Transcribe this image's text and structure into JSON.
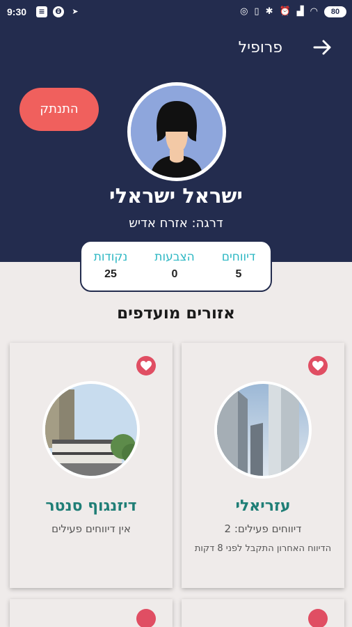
{
  "status_bar": {
    "time": "9:30",
    "battery": "80"
  },
  "header": {
    "title": "פרופיל",
    "back_icon": "arrow-right-icon",
    "logout_label": "התנתק"
  },
  "user": {
    "name": "ישראל ישראלי",
    "rank": "דרגה: אזרח אדיש"
  },
  "stats": [
    {
      "label": "דיווחים",
      "value": "5"
    },
    {
      "label": "הצבעות",
      "value": "0"
    },
    {
      "label": "נקודות",
      "value": "25"
    }
  ],
  "favorites": {
    "title": "אזורים מועדפים",
    "areas": [
      {
        "name": "עזריאלי",
        "line1": "דיווחים פעילים: 2",
        "line2": "הדיווח האחרון התקבל לפני 8 דקות"
      },
      {
        "name": "דיזנגוף סנטר",
        "line1": "אין דיווחים פעילים",
        "line2": ""
      }
    ]
  },
  "colors": {
    "header_bg": "#232c4e",
    "logout_bg": "#f0605d",
    "accent_teal": "#2cb7c3",
    "area_name": "#1f7e76",
    "heart": "#e04e63"
  }
}
